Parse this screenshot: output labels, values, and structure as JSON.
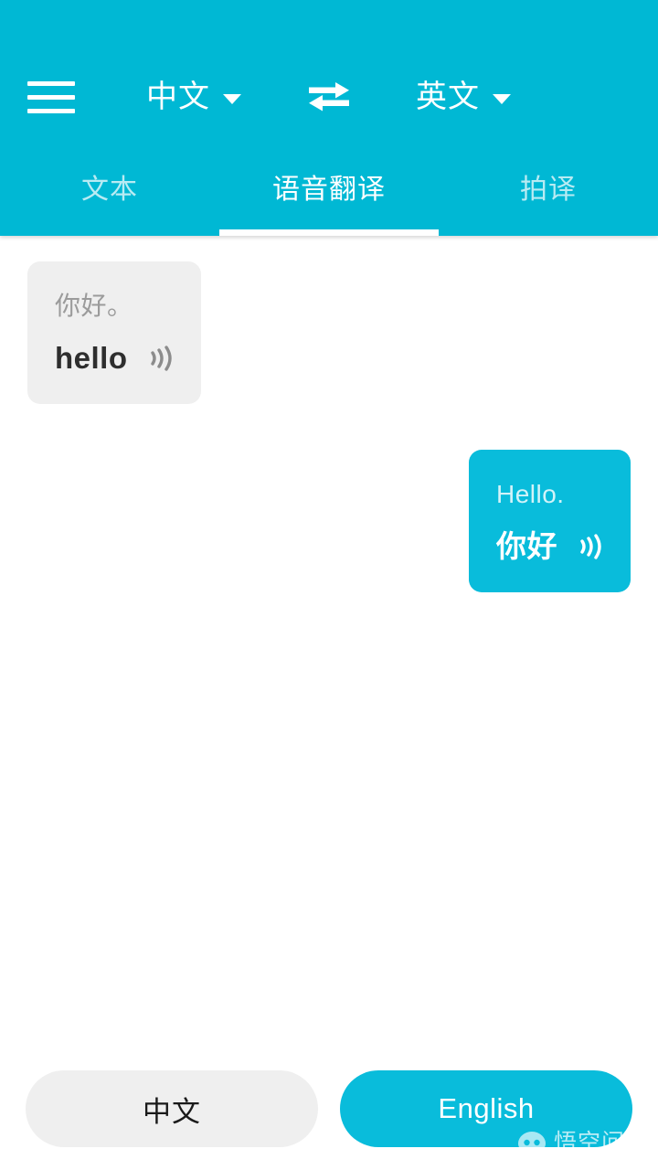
{
  "theme": {
    "accent": "#00b8d4",
    "bubble_accent": "#09bcdb",
    "bubble_gray": "#efefef",
    "background": "#ffffff",
    "muted_text": "#9b9b9b",
    "dark_text": "#2e2e2e"
  },
  "header": {
    "menu_icon": "hamburger-menu-icon",
    "source_language": "中文",
    "target_language": "英文",
    "swap_icon": "swap-horizontal-icon",
    "caret_icon": "chevron-down-icon",
    "tabs": [
      {
        "label": "文本",
        "active": false
      },
      {
        "label": "语音翻译",
        "active": true
      },
      {
        "label": "拍译",
        "active": false
      }
    ]
  },
  "conversation": {
    "messages": [
      {
        "side": "incoming",
        "source_text": "你好。",
        "translated_text": "hello",
        "speaker_icon": "speaker-waves-icon"
      },
      {
        "side": "outgoing",
        "source_text": "Hello.",
        "translated_text": "你好",
        "speaker_icon": "speaker-waves-icon"
      }
    ]
  },
  "bottom_bar": {
    "left_button": "中文",
    "right_button": "English"
  },
  "watermark": {
    "text": "悟空问答",
    "logo_icon": "wukong-logo-icon"
  }
}
